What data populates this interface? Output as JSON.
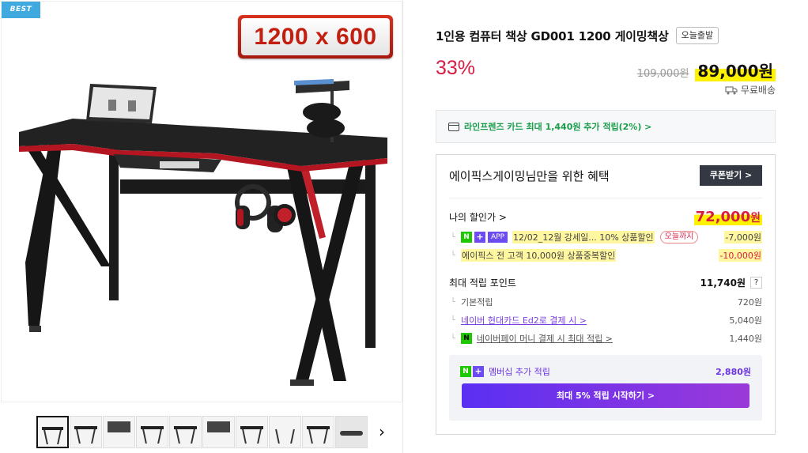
{
  "product": {
    "best_badge": "BEST",
    "size_badge": "1200 x 600",
    "title": "1인용 컴퓨터 책상 GD001 1200 게이밍책상",
    "today_tag": "오늘출발",
    "discount_rate": "33%",
    "original_price": "109,000원",
    "sale_price": "89,000원",
    "shipping": "무료배송",
    "thumbnail_count": 10
  },
  "card_promo": "라인프렌즈 카드 최대 1,440원 추가 적립(2%) >",
  "benefits": {
    "heading": "에이픽스게이밍님만을 위한 혜택",
    "coupon_button": "쿠폰받기 >",
    "my_price_label": "나의 할인가 >",
    "my_price_value": "72,000",
    "my_price_unit": "원",
    "discounts": [
      {
        "badges": [
          "N",
          "+",
          "APP"
        ],
        "label": "12/02_12월 강세일...  10% 상품할인",
        "tag": "오늘까지",
        "amount": "-7,000원"
      },
      {
        "label": "에이픽스 전 고객 10,000원 상품중복할인",
        "amount": "-10,000원"
      }
    ],
    "points_label": "최대 적립 포인트",
    "points_value": "11,740원",
    "points_help": "?",
    "point_rows": [
      {
        "label": "기본적립",
        "value": "720원"
      },
      {
        "label": "네이버 현대카드 Ed2로 결제 시 >",
        "value": "5,040원"
      },
      {
        "label": "네이버페이 머니 결제 시 최대 적립 >",
        "value": "1,440원"
      }
    ],
    "membership": {
      "label": "멤버십 추가 적립",
      "value": "2,880원",
      "button": "최대 5% 적립 시작하기 >"
    }
  },
  "colors": {
    "accent_red": "#d81d43",
    "naver_green": "#1ec800",
    "membership_purple": "#6c4cf0",
    "best_blue": "#3fa9e0"
  },
  "icons": [
    "truck-icon",
    "card-icon",
    "chevron-right-icon",
    "question-icon",
    "naver-pay-icon"
  ]
}
